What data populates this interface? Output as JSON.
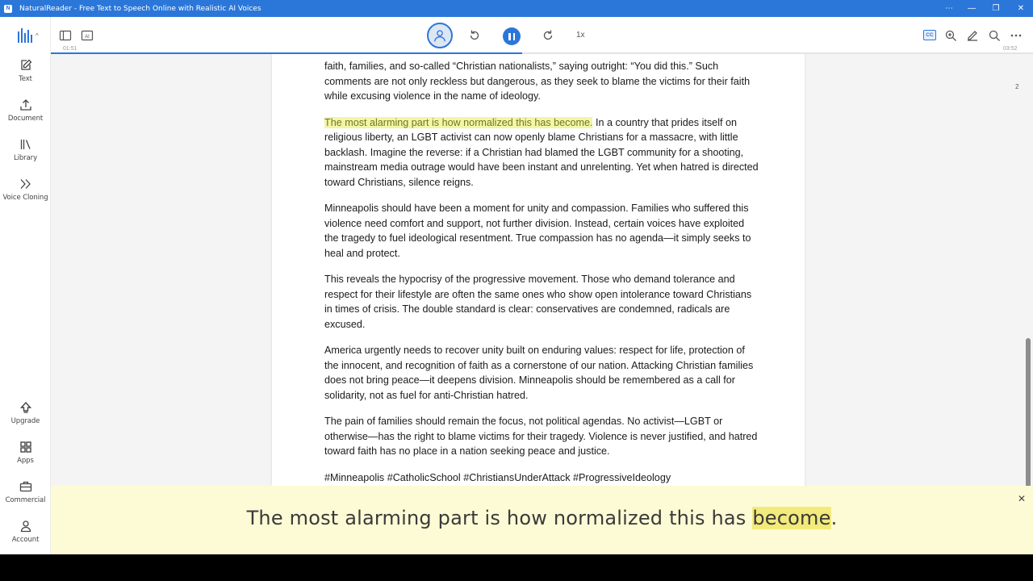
{
  "window": {
    "title": "NaturalReader - Free Text to Speech Online with Realistic AI Voices",
    "controls": [
      "⋯",
      "—",
      "❐",
      "✕"
    ]
  },
  "sidebar": {
    "items": [
      {
        "label": "Text",
        "icon": "edit-icon"
      },
      {
        "label": "Document",
        "icon": "upload-icon"
      },
      {
        "label": "Library",
        "icon": "library-icon"
      },
      {
        "label": "Voice Cloning",
        "icon": "voice-cloning-icon"
      }
    ],
    "bottom_items": [
      {
        "label": "Upgrade",
        "icon": "upgrade-icon"
      },
      {
        "label": "Apps",
        "icon": "apps-icon"
      },
      {
        "label": "Commercial",
        "icon": "briefcase-icon"
      },
      {
        "label": "Account",
        "icon": "account-icon"
      }
    ]
  },
  "player": {
    "elapsed": "01:51",
    "total": "03:52",
    "progress": 0.48,
    "speed": "1x",
    "cc_label": "CC"
  },
  "document": {
    "page_number": "2",
    "first_paragraph": "faith, families, and so-called “Christian nationalists,” saying outright: “You did this.” Such comments are not only reckless but dangerous, as they seek to blame the victims for their faith while excusing violence in the name of ideology.",
    "highlighted_sentence": "The most alarming part is how normalized this has become.",
    "paragraph2_rest": " In a country that prides itself on religious liberty, an LGBT activist can now openly blame Christians for a massacre, with little backlash. Imagine the reverse: if a Christian had blamed the LGBT community for a shooting, mainstream media outrage would have been instant and unrelenting. Yet when hatred is directed toward Christians, silence reigns.",
    "paragraphs": [
      "Minneapolis should have been a moment for unity and compassion. Families who suffered this violence need comfort and support, not further division. Instead, certain voices have exploited the tragedy to fuel ideological resentment. True compassion has no agenda—it simply seeks to heal and protect.",
      "This reveals the hypocrisy of the progressive movement. Those who demand tolerance and respect for their lifestyle are often the same ones who show open intolerance toward Christians in times of crisis. The double standard is clear: conservatives are condemned, radicals are excused.",
      "America urgently needs to recover unity built on enduring values: respect for life, protection of the innocent, and recognition of faith as a cornerstone of our nation. Attacking Christian families does not bring peace—it deepens division. Minneapolis should be remembered as a call for solidarity, not as fuel for anti-Christian hatred.",
      "The pain of families should remain the focus, not political agendas. No activist—LGBT or otherwise—has the right to blame victims for their tragedy. Violence is never justified, and hatred toward faith has no place in a nation seeking peace and justice.",
      "#Minneapolis #CatholicSchool #ChristiansUnderAttack #ProgressiveIdeology"
    ]
  },
  "caption": {
    "before": "The most alarming part is how normalized this has ",
    "current_word": "become",
    "after": "."
  },
  "colors": {
    "accent": "#2b77d9",
    "highlight": "#f4f5a8",
    "caption_bg": "#fdfbd5"
  }
}
